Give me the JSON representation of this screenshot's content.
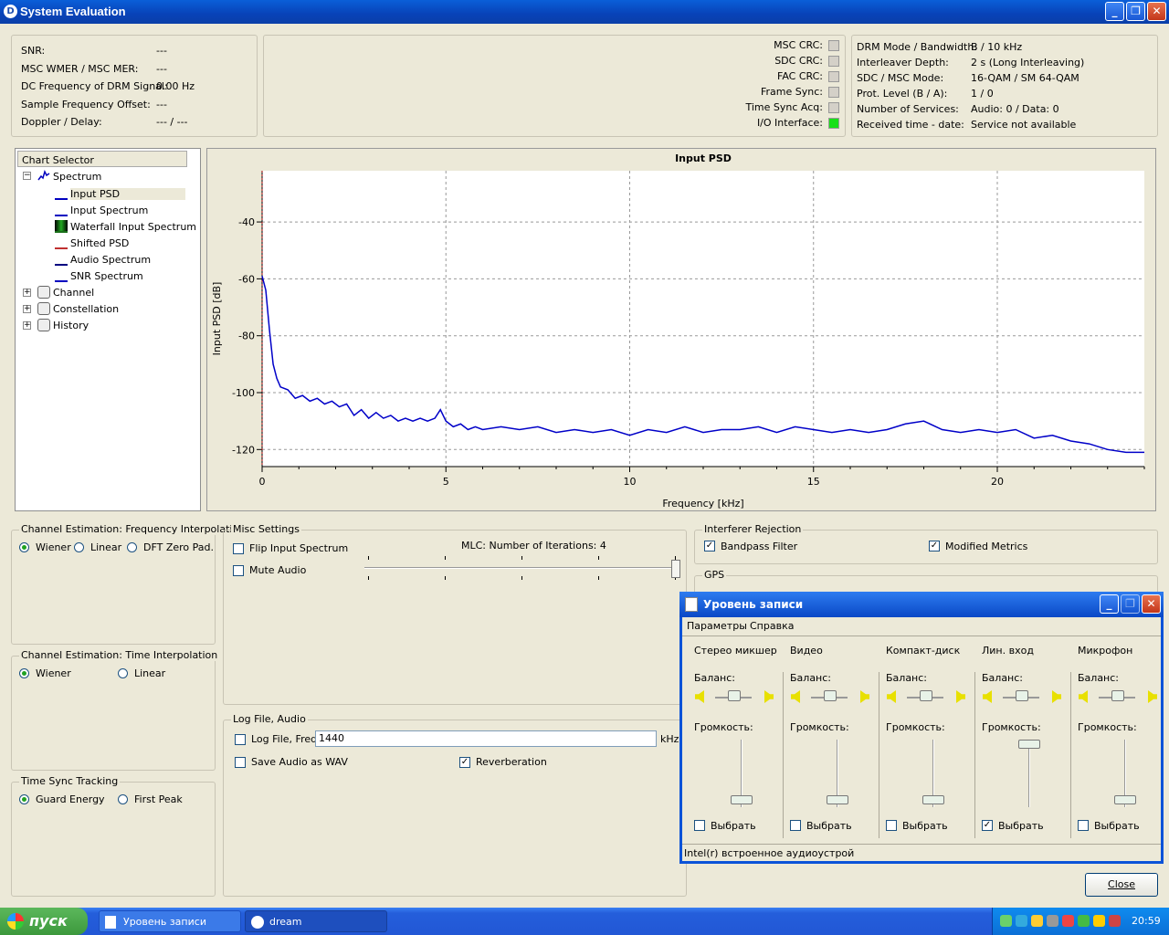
{
  "window": {
    "title": "System Evaluation",
    "app_icon": "D"
  },
  "status": {
    "rows": [
      {
        "label": "SNR:",
        "value": "---"
      },
      {
        "label": "MSC WMER / MSC MER:",
        "value": "---"
      },
      {
        "label": "DC Frequency of DRM Signal:",
        "value": "0.00 Hz"
      },
      {
        "label": "Sample Frequency Offset:",
        "value": "---"
      },
      {
        "label": "Doppler / Delay:",
        "value": "--- / ---"
      }
    ],
    "crc": [
      {
        "label": "MSC CRC:",
        "state": "off"
      },
      {
        "label": "SDC CRC:",
        "state": "off"
      },
      {
        "label": "FAC CRC:",
        "state": "off"
      },
      {
        "label": "Frame Sync:",
        "state": "off"
      },
      {
        "label": "Time Sync Acq:",
        "state": "off"
      },
      {
        "label": "I/O Interface:",
        "state": "on"
      }
    ],
    "info": [
      {
        "label": "DRM Mode / Bandwidth:",
        "value": "B / 10 kHz"
      },
      {
        "label": "Interleaver Depth:",
        "value": "2 s (Long Interleaving)"
      },
      {
        "label": "SDC / MSC Mode:",
        "value": "16-QAM / SM 64-QAM"
      },
      {
        "label": "Prot. Level (B / A):",
        "value": "1 / 0"
      },
      {
        "label": "Number of Services:",
        "value": "Audio: 0 / Data: 0"
      },
      {
        "label": "Received time - date:",
        "value": "Service not available"
      }
    ]
  },
  "tree": {
    "header": "Chart Selector",
    "spectrum": "Spectrum",
    "children": [
      "Input PSD",
      "Input Spectrum",
      "Waterfall Input Spectrum",
      "Shifted PSD",
      "Audio Spectrum",
      "SNR Spectrum"
    ],
    "collapsed": [
      "Channel",
      "Constellation",
      "History"
    ],
    "selected": "Input PSD"
  },
  "chart_data": {
    "type": "line",
    "title": "Input PSD",
    "xlabel": "Frequency [kHz]",
    "ylabel": "Input PSD [dB]",
    "xlim": [
      0,
      24
    ],
    "ylim": [
      -126,
      -22
    ],
    "xticks": [
      0,
      5,
      10,
      15,
      20
    ],
    "yticks": [
      -40,
      -60,
      -80,
      -100,
      -120
    ],
    "grid": true,
    "line_color": "#0000c8",
    "marker_x": 0,
    "series": [
      {
        "x": [
          0,
          0.1,
          0.2,
          0.3,
          0.4,
          0.5,
          0.7,
          0.9,
          1.1,
          1.3,
          1.5,
          1.7,
          1.9,
          2.1,
          2.3,
          2.5,
          2.7,
          2.9,
          3.1,
          3.3,
          3.5,
          3.7,
          3.9,
          4.1,
          4.3,
          4.5,
          4.7,
          4.85,
          5.0,
          5.2,
          5.4,
          5.6,
          5.8,
          6.0,
          6.5,
          7.0,
          7.5,
          8.0,
          8.5,
          9.0,
          9.5,
          10.0,
          10.5,
          11.0,
          11.5,
          12.0,
          12.5,
          13.0,
          13.5,
          14.0,
          14.5,
          15.0,
          15.5,
          16.0,
          16.5,
          17.0,
          17.5,
          18.0,
          18.5,
          19.0,
          19.5,
          20.0,
          20.5,
          21.0,
          21.5,
          22.0,
          22.5,
          23.0,
          23.5,
          24.0
        ],
        "y": [
          -59,
          -64,
          -78,
          -90,
          -95,
          -98,
          -99,
          -102,
          -101,
          -103,
          -102,
          -104,
          -103,
          -105,
          -104,
          -108,
          -106,
          -109,
          -107,
          -109,
          -108,
          -110,
          -109,
          -110,
          -109,
          -110,
          -109,
          -106,
          -110,
          -112,
          -111,
          -113,
          -112,
          -113,
          -112,
          -113,
          -112,
          -114,
          -113,
          -114,
          -113,
          -115,
          -113,
          -114,
          -112,
          -114,
          -113,
          -113,
          -112,
          -114,
          -112,
          -113,
          -114,
          -113,
          -114,
          -113,
          -111,
          -110,
          -113,
          -114,
          -113,
          -114,
          -113,
          -116,
          -115,
          -117,
          -118,
          -120,
          -121,
          -121
        ]
      }
    ]
  },
  "chan_freq": {
    "title": "Channel Estimation: Frequency Interpolation",
    "options": [
      "Wiener",
      "Linear",
      "DFT Zero Pad."
    ],
    "selected": "Wiener"
  },
  "chan_time": {
    "title": "Channel Estimation: Time Interpolation",
    "options": [
      "Wiener",
      "Linear"
    ],
    "selected": "Wiener"
  },
  "time_sync": {
    "title": "Time Sync Tracking",
    "options": [
      "Guard Energy",
      "First Peak"
    ],
    "selected": "Guard Energy"
  },
  "misc": {
    "title": "Misc Settings",
    "flip": "Flip Input Spectrum",
    "mute": "Mute Audio",
    "mlc": "MLC: Number of Iterations: 4"
  },
  "logfile": {
    "title": "Log File, Audio",
    "log_label": "Log File, Freq:",
    "freq": "1440",
    "unit": "kHz",
    "save_wav": "Save Audio as WAV",
    "reverb": "Reverberation"
  },
  "interferer": {
    "title": "Interferer Rejection",
    "bandpass": "Bandpass Filter",
    "modified": "Modified Metrics"
  },
  "gps": {
    "title": "GPS"
  },
  "close_button": "Close",
  "mixer": {
    "title": "Уровень записи",
    "menu": [
      "Параметры",
      "Справка"
    ],
    "balance_label": "Баланс:",
    "volume_label": "Громкость:",
    "select_label": "Выбрать",
    "channels": [
      {
        "name": "Стерео микшер",
        "selected": false,
        "volume": 0.1
      },
      {
        "name": "Видео",
        "selected": false,
        "volume": 0.1
      },
      {
        "name": "Компакт-диск",
        "selected": false,
        "volume": 0.1
      },
      {
        "name": "Лин. вход",
        "selected": true,
        "volume": 1.0
      },
      {
        "name": "Микрофон",
        "selected": false,
        "volume": 0.1
      }
    ],
    "status": "Intel(r) встроенное аудиоустрой"
  },
  "taskbar": {
    "start": "пуск",
    "tasks": [
      "Уровень записи",
      "dream"
    ],
    "clock": "20:59"
  }
}
